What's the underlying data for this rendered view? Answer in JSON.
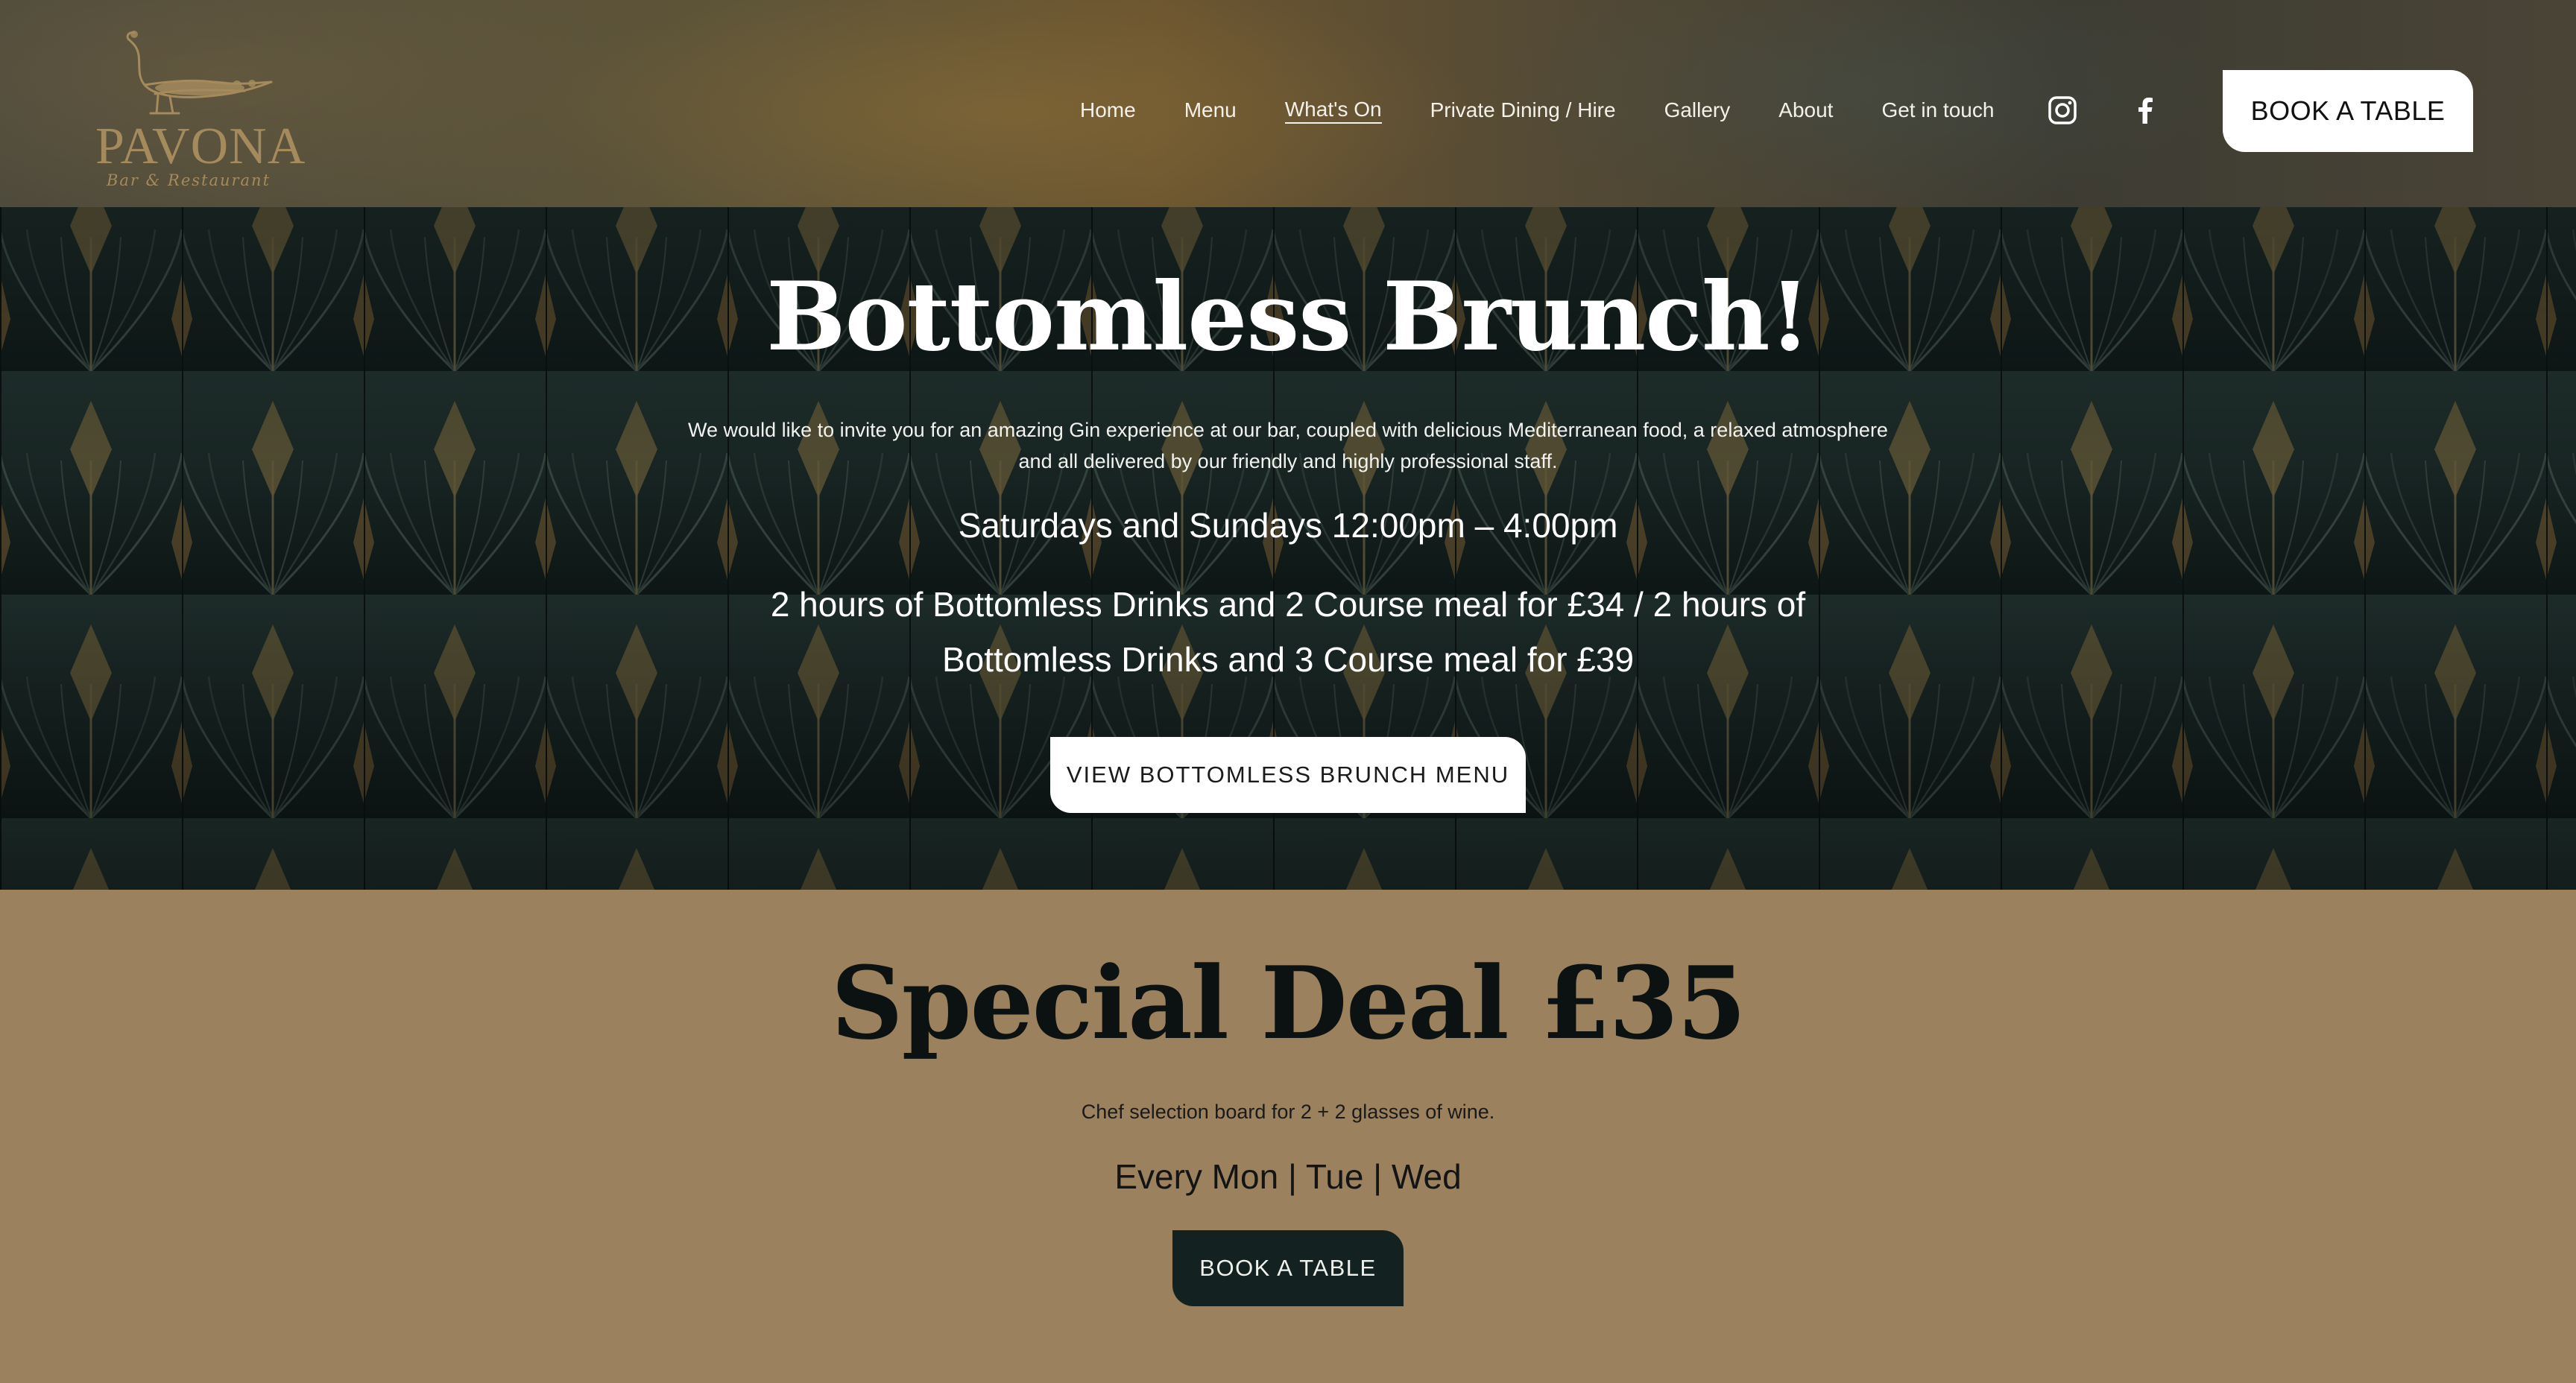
{
  "brand": {
    "name": "PAVONA",
    "tagline": "Bar & Restaurant",
    "gold": "#a48a5c"
  },
  "nav": {
    "items": [
      {
        "label": "Home"
      },
      {
        "label": "Menu"
      },
      {
        "label": "What's On",
        "active": true
      },
      {
        "label": "Private Dining / Hire"
      },
      {
        "label": "Gallery"
      },
      {
        "label": "About"
      },
      {
        "label": "Get in touch"
      }
    ],
    "social_icons": [
      "instagram-icon",
      "facebook-icon"
    ],
    "book_label": "BOOK A TABLE"
  },
  "hero": {
    "title": "Bottomless Brunch!",
    "intro": "We would like to invite you for an amazing Gin experience at our bar, coupled with delicious Mediterranean food, a relaxed atmosphere and all delivered by our friendly and highly professional staff.",
    "days": "Saturdays and Sundays 12:00pm – 4:00pm",
    "offer": "2 hours of Bottomless Drinks and 2 Course meal for £34 / 2 hours of Bottomless Drinks and 3 Course meal for £39",
    "button_label": "VIEW BOTTOMLESS BRUNCH MENU",
    "background_color": "#172523"
  },
  "deal": {
    "title": "Special Deal £35",
    "description": "Chef selection board for 2 + 2 glasses of wine.",
    "days": "Every Mon | Tue | Wed",
    "button_label": "BOOK A TABLE",
    "background_color": "#9b815e",
    "button_color": "#132220"
  }
}
